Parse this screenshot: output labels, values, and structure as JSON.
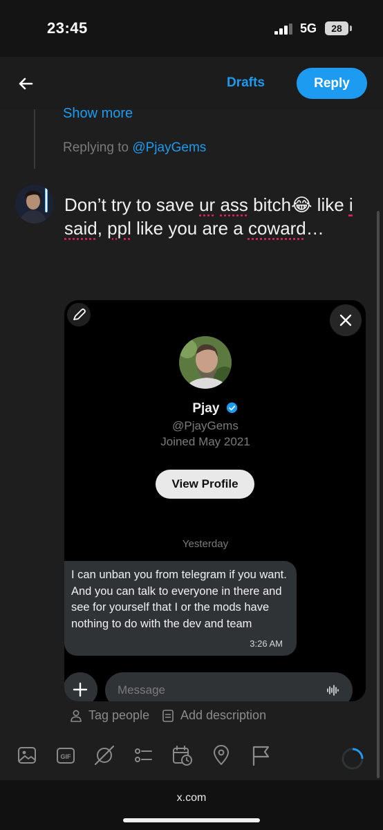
{
  "status_bar": {
    "time": "23:45",
    "network": "5G",
    "battery": "28"
  },
  "header": {
    "drafts_label": "Drafts",
    "reply_label": "Reply"
  },
  "context": {
    "show_more": "Show more",
    "replying_prefix": "Replying to ",
    "replying_handle": "@PjayGems"
  },
  "compose": {
    "text_parts": [
      "Don’t try to save ",
      "ur",
      " ",
      "ass",
      " ",
      "bitch",
      "😂 like ",
      "i",
      " ",
      "said",
      ", ",
      "ppl",
      " like you are a ",
      "coward",
      "…"
    ]
  },
  "attachment": {
    "profile_name": "Pjay",
    "profile_handle": "@PjayGems",
    "joined": "Joined May 2021",
    "view_profile_label": "View Profile",
    "date_label": "Yesterday",
    "message": "I can unban you from telegram if you want. And you can talk to everyone in there and see for yourself that I or the mods have nothing to do with the dev and team",
    "message_time": "3:26 AM",
    "input_placeholder": "Message"
  },
  "media_actions": {
    "tag_people": "Tag people",
    "add_description": "Add description"
  },
  "toolbar_icons": [
    "image-icon",
    "gif-icon",
    "grok-icon",
    "poll-icon",
    "schedule-icon",
    "location-icon",
    "flag-icon"
  ],
  "browser": {
    "url": "x.com"
  },
  "colors": {
    "accent": "#1d9bf0",
    "background": "#1e1e1e",
    "bubble": "#2f3336"
  }
}
